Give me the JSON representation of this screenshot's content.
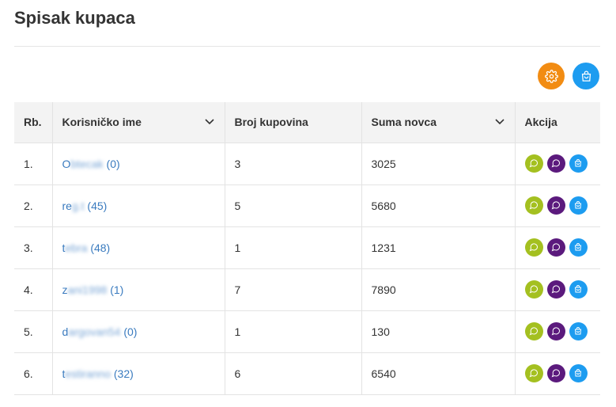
{
  "page": {
    "title": "Spisak kupaca"
  },
  "toolbar": {
    "settings_icon": "gear-icon",
    "cart_icon": "shopping-bag-icon"
  },
  "colors": {
    "orange": "#f28c13",
    "blue": "#1d9cf0",
    "green": "#a4c020",
    "purple": "#5b1a7d",
    "link": "#3a7bbf"
  },
  "table": {
    "headers": {
      "rb": "Rb.",
      "username": "Korisničko ime",
      "purchases": "Broj kupovina",
      "sum": "Suma novca",
      "actions": "Akcija"
    },
    "rows": [
      {
        "rb": "1.",
        "name_start": "O",
        "name_blur": "btecak",
        "count": "(0)",
        "purchases": "3",
        "sum": "3025"
      },
      {
        "rb": "2.",
        "name_start": "re",
        "name_blur": "g.t",
        "count": "(45)",
        "purchases": "5",
        "sum": "5680"
      },
      {
        "rb": "3.",
        "name_start": "t",
        "name_blur": "ebra",
        "count": "(48)",
        "purchases": "1",
        "sum": "1231"
      },
      {
        "rb": "4.",
        "name_start": "z",
        "name_blur": "ani1998",
        "count": "(1)",
        "purchases": "7",
        "sum": "7890"
      },
      {
        "rb": "5.",
        "name_start": "d",
        "name_blur": "argovan54",
        "count": "(0)",
        "purchases": "1",
        "sum": "130"
      },
      {
        "rb": "6.",
        "name_start": "t",
        "name_blur": "estiranno",
        "count": "(32)",
        "purchases": "6",
        "sum": "6540"
      }
    ]
  }
}
